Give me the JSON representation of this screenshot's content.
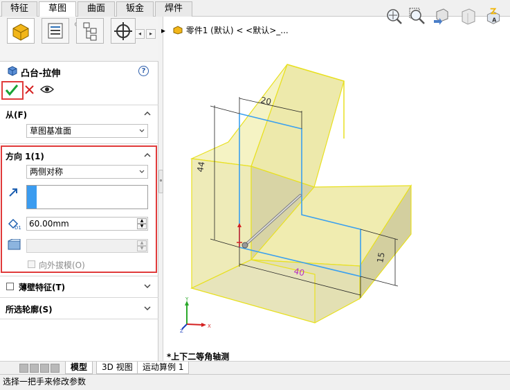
{
  "command_tabs": [
    "特征",
    "草图",
    "曲面",
    "钣金",
    "焊件"
  ],
  "active_tab": "草图",
  "property_manager": {
    "title": "凸台-拉伸",
    "help_symbol": "?",
    "from_section": {
      "label": "从(F)",
      "value": "草图基准面"
    },
    "direction1": {
      "label": "方向 1(1)",
      "end_condition": "两侧对称",
      "depth": "60.00mm"
    },
    "draft_outward": "向外拔模(O)",
    "thin_feature": "薄壁特征(T)",
    "selected_contours": "所选轮廓(S)"
  },
  "feature_tree": {
    "expand_symbol": "▸",
    "path": "零件1 (默认) < <默认>_..."
  },
  "dimensions": {
    "top": "20",
    "left": "44",
    "bottom": "40",
    "right": "15"
  },
  "triad": {
    "x": "X",
    "y": "Y",
    "z": "Z"
  },
  "view_label": "*上下二等角轴测",
  "bottom_tabs": [
    "模型",
    "3D 视图",
    "运动算例 1"
  ],
  "status_text": "选择一把手来修改参数",
  "colors": {
    "highlight": "#e03a3a",
    "accept": "#1aa335",
    "cancel": "#d62020",
    "model_face": "#f3f1b8",
    "model_edge": "#e8e020",
    "sketch": "#3aa0ef"
  }
}
